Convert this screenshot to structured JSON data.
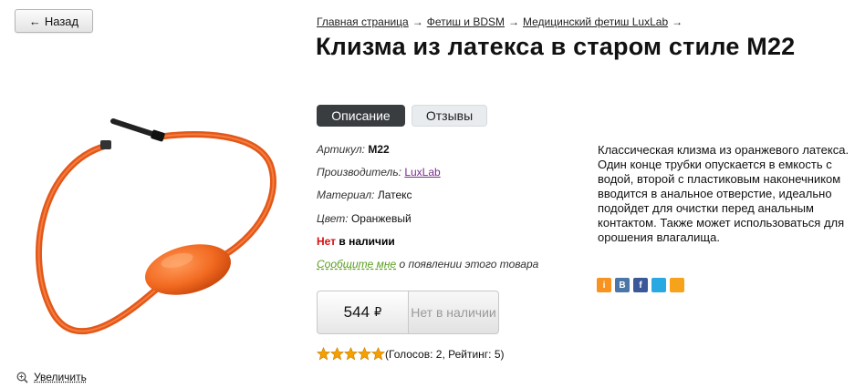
{
  "nav": {
    "back_arrow": "←",
    "back_label": "Назад"
  },
  "breadcrumb": {
    "items": [
      "Главная страница",
      "Фетиш и BDSM",
      "Медицинский фетиш LuxLab"
    ],
    "separator": "→"
  },
  "product": {
    "title": "Клизма из латекса в старом стиле M22",
    "image_icon": "enema-bulb-image",
    "image_color": "#f26a21",
    "zoom_label": "Увеличить",
    "zoom_icon": "zoom-in-icon"
  },
  "tabs": [
    {
      "label": "Описание",
      "active": true
    },
    {
      "label": "Отзывы",
      "active": false
    }
  ],
  "attributes": {
    "sku_label": "Артикул:",
    "sku_value": "M22",
    "manufacturer_label": "Производитель:",
    "manufacturer_value": "LuxLab",
    "material_label": "Материал:",
    "material_value": "Латекс",
    "color_label": "Цвет:",
    "color_value": "Оранжевый"
  },
  "stock": {
    "prefix": "Нет",
    "suffix": "в наличии",
    "prefix_color": "#d41111"
  },
  "notify": {
    "link": "Сообщите мне",
    "rest": "о появлении этого товара"
  },
  "price": {
    "value": "544",
    "currency": "₽"
  },
  "buy_button_label": "Нет в наличии",
  "rating": {
    "stars_filled": 5,
    "stars_total": 5,
    "text": "(Голосов: 2, Рейтинг: 5)",
    "star_color": "#f5a000"
  },
  "description": "Классическая клизма из оранжевого латекса. Один конце трубки опускается в емкость с водой, второй с пластиковым наконечником вводится в анальное отверстие, идеально подойдет для очистки перед анальным контактом. Также может использоваться для орошения влагалища.",
  "share": [
    {
      "name": "odnoklassniki-icon",
      "color": "#f7931e",
      "glyph": "i"
    },
    {
      "name": "vkontakte-icon",
      "color": "#4a76a8",
      "glyph": "B"
    },
    {
      "name": "facebook-icon",
      "color": "#3b5998",
      "glyph": "f"
    },
    {
      "name": "twitter-icon",
      "color": "#29a9e1",
      "glyph": ""
    },
    {
      "name": "moimir-icon",
      "color": "#f7a21b",
      "glyph": ""
    }
  ]
}
